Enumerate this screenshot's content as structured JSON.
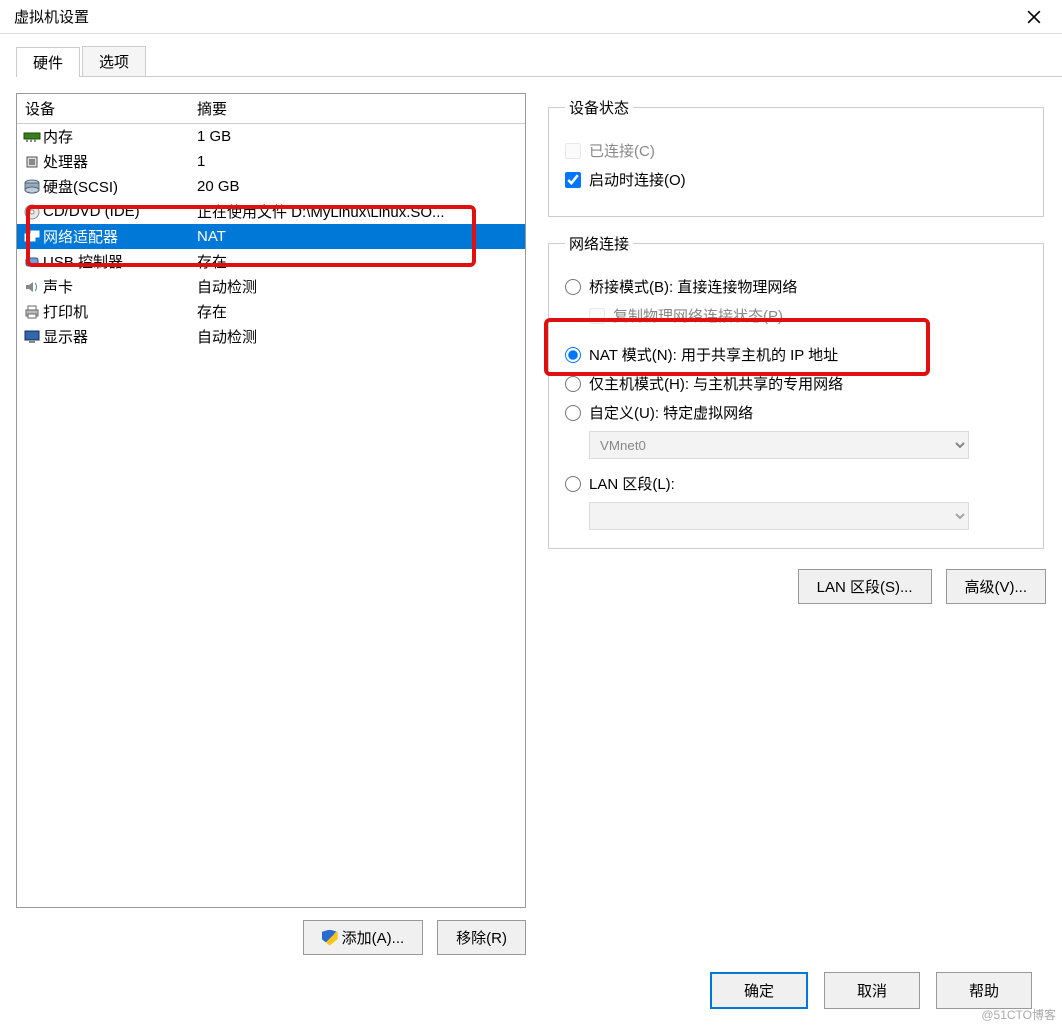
{
  "title": "虚拟机设置",
  "tabs": {
    "hardware": "硬件",
    "options": "选项"
  },
  "table": {
    "head_device": "设备",
    "head_summary": "摘要",
    "rows": [
      {
        "name": "内存",
        "summary": "1 GB",
        "icon": "memory"
      },
      {
        "name": "处理器",
        "summary": "1",
        "icon": "cpu"
      },
      {
        "name": "硬盘(SCSI)",
        "summary": "20 GB",
        "icon": "disk"
      },
      {
        "name": "CD/DVD (IDE)",
        "summary": "正在使用文件 D:\\MyLinux\\Linux.SO...",
        "icon": "cd"
      },
      {
        "name": "网络适配器",
        "summary": "NAT",
        "icon": "net",
        "selected": true
      },
      {
        "name": "USB 控制器",
        "summary": "存在",
        "icon": "usb"
      },
      {
        "name": "声卡",
        "summary": "自动检测",
        "icon": "sound"
      },
      {
        "name": "打印机",
        "summary": "存在",
        "icon": "printer"
      },
      {
        "name": "显示器",
        "summary": "自动检测",
        "icon": "display"
      }
    ]
  },
  "buttons": {
    "add": "添加(A)...",
    "remove": "移除(R)",
    "lan": "LAN 区段(S)...",
    "advanced": "高级(V)...",
    "ok": "确定",
    "cancel": "取消",
    "help": "帮助"
  },
  "device_state": {
    "legend": "设备状态",
    "connected": "已连接(C)",
    "connect_on_start": "启动时连接(O)"
  },
  "net": {
    "legend": "网络连接",
    "bridge": "桥接模式(B): 直接连接物理网络",
    "replicate": "复制物理网络连接状态(P)",
    "nat": "NAT 模式(N): 用于共享主机的 IP 地址",
    "hostonly": "仅主机模式(H): 与主机共享的专用网络",
    "custom": "自定义(U): 特定虚拟网络",
    "custom_value": "VMnet0",
    "lan": "LAN 区段(L):"
  },
  "watermark": "@51CTO博客"
}
